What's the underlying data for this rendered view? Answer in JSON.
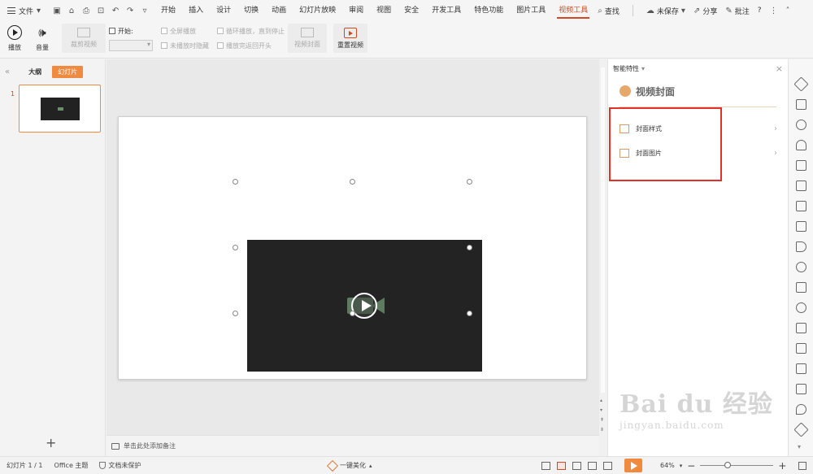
{
  "menubar": {
    "file_label": "文件",
    "tabs": [
      "开始",
      "插入",
      "设计",
      "切换",
      "动画",
      "幻灯片放映",
      "审阅",
      "视图",
      "安全",
      "开发工具",
      "特色功能",
      "图片工具",
      "视频工具"
    ],
    "active_tab": "视频工具",
    "search_label": "查找",
    "unsaved_label": "未保存",
    "share_label": "分享",
    "annotate_label": "批注",
    "help_label": "?"
  },
  "ribbon": {
    "play_label": "播放",
    "volume_label": "音量",
    "trim_label": "裁剪视频",
    "start_label": "开始:",
    "fullscreen_label": "全屏播放",
    "hide_unplayed_label": "未播放时隐藏",
    "loop_label": "循环播放，直到停止",
    "rewind_label": "播放完返回开头",
    "cover_label": "视频封面",
    "reset_label": "重置视频"
  },
  "leftpanel": {
    "outline_tab": "大纲",
    "slides_tab": "幻灯片",
    "slide_number": "1",
    "add_label": "+"
  },
  "notes": {
    "placeholder": "单击此处添加备注"
  },
  "taskpane": {
    "header": "智能特性",
    "title": "视频封面",
    "items": [
      {
        "label": "封面样式"
      },
      {
        "label": "封面图片"
      }
    ]
  },
  "statusbar": {
    "slide_info": "幻灯片 1 / 1",
    "theme": "Office 主题",
    "protection": "文档未保护",
    "beautify": "一键美化",
    "zoom": "64%"
  },
  "watermark": {
    "main": "Bai du 经验",
    "sub": "jingyan.baidu.com"
  },
  "colors": {
    "accent": "#d24726",
    "orange": "#f08a3e",
    "highlight_box": "#e3312a"
  }
}
